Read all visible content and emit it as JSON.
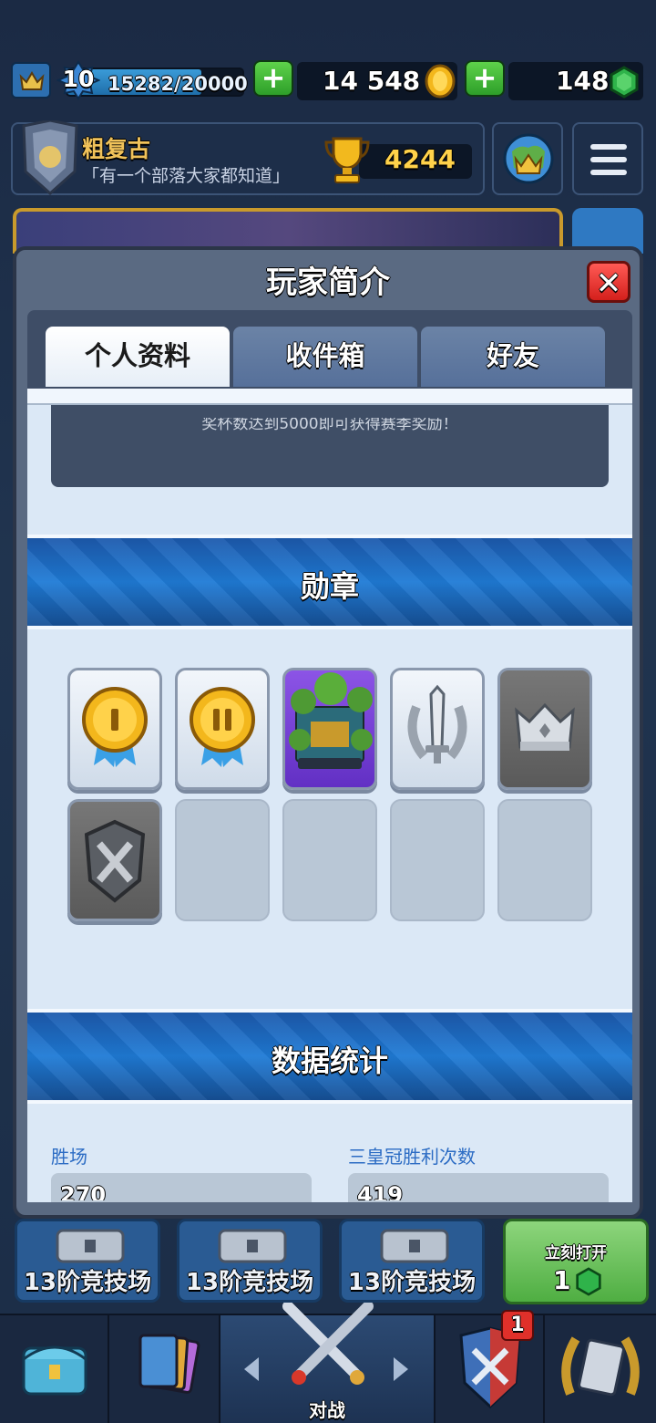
{
  "topbar": {
    "level": "10",
    "xp": "15282/20000",
    "xp_fraction": 0.764,
    "gold": "14 548",
    "gems": "148",
    "plus_label": "+"
  },
  "player": {
    "name": "粗复古",
    "clan": "「有一个部落大家都知道」",
    "trophies": "4244"
  },
  "modal": {
    "title": "玩家简介",
    "close_label": "✕",
    "tabs": [
      {
        "label": "个人资料",
        "active": true
      },
      {
        "label": "收件箱",
        "active": false
      },
      {
        "label": "好友",
        "active": false
      }
    ],
    "season_text": "奖杯数达到5000即可获得赛季奖励！",
    "badges_title": "勋章",
    "stats_title": "数据统计",
    "stats": [
      {
        "label": "胜场",
        "value": "270"
      },
      {
        "label": "三皇冠胜利次数",
        "value": "419"
      }
    ]
  },
  "chests": [
    {
      "label": "13阶竞技场"
    },
    {
      "label": "13阶竞技场"
    },
    {
      "label": "13阶竞技场"
    }
  ],
  "special_chest": {
    "label": "立刻打开",
    "cost": "1"
  },
  "nav": {
    "battle_label": "对战",
    "notification_count": "1"
  },
  "colors": {
    "accent_blue": "#1f7bd6",
    "gold": "#ffd24a",
    "gem_green": "#2fb34a",
    "close_red": "#d4201c"
  }
}
